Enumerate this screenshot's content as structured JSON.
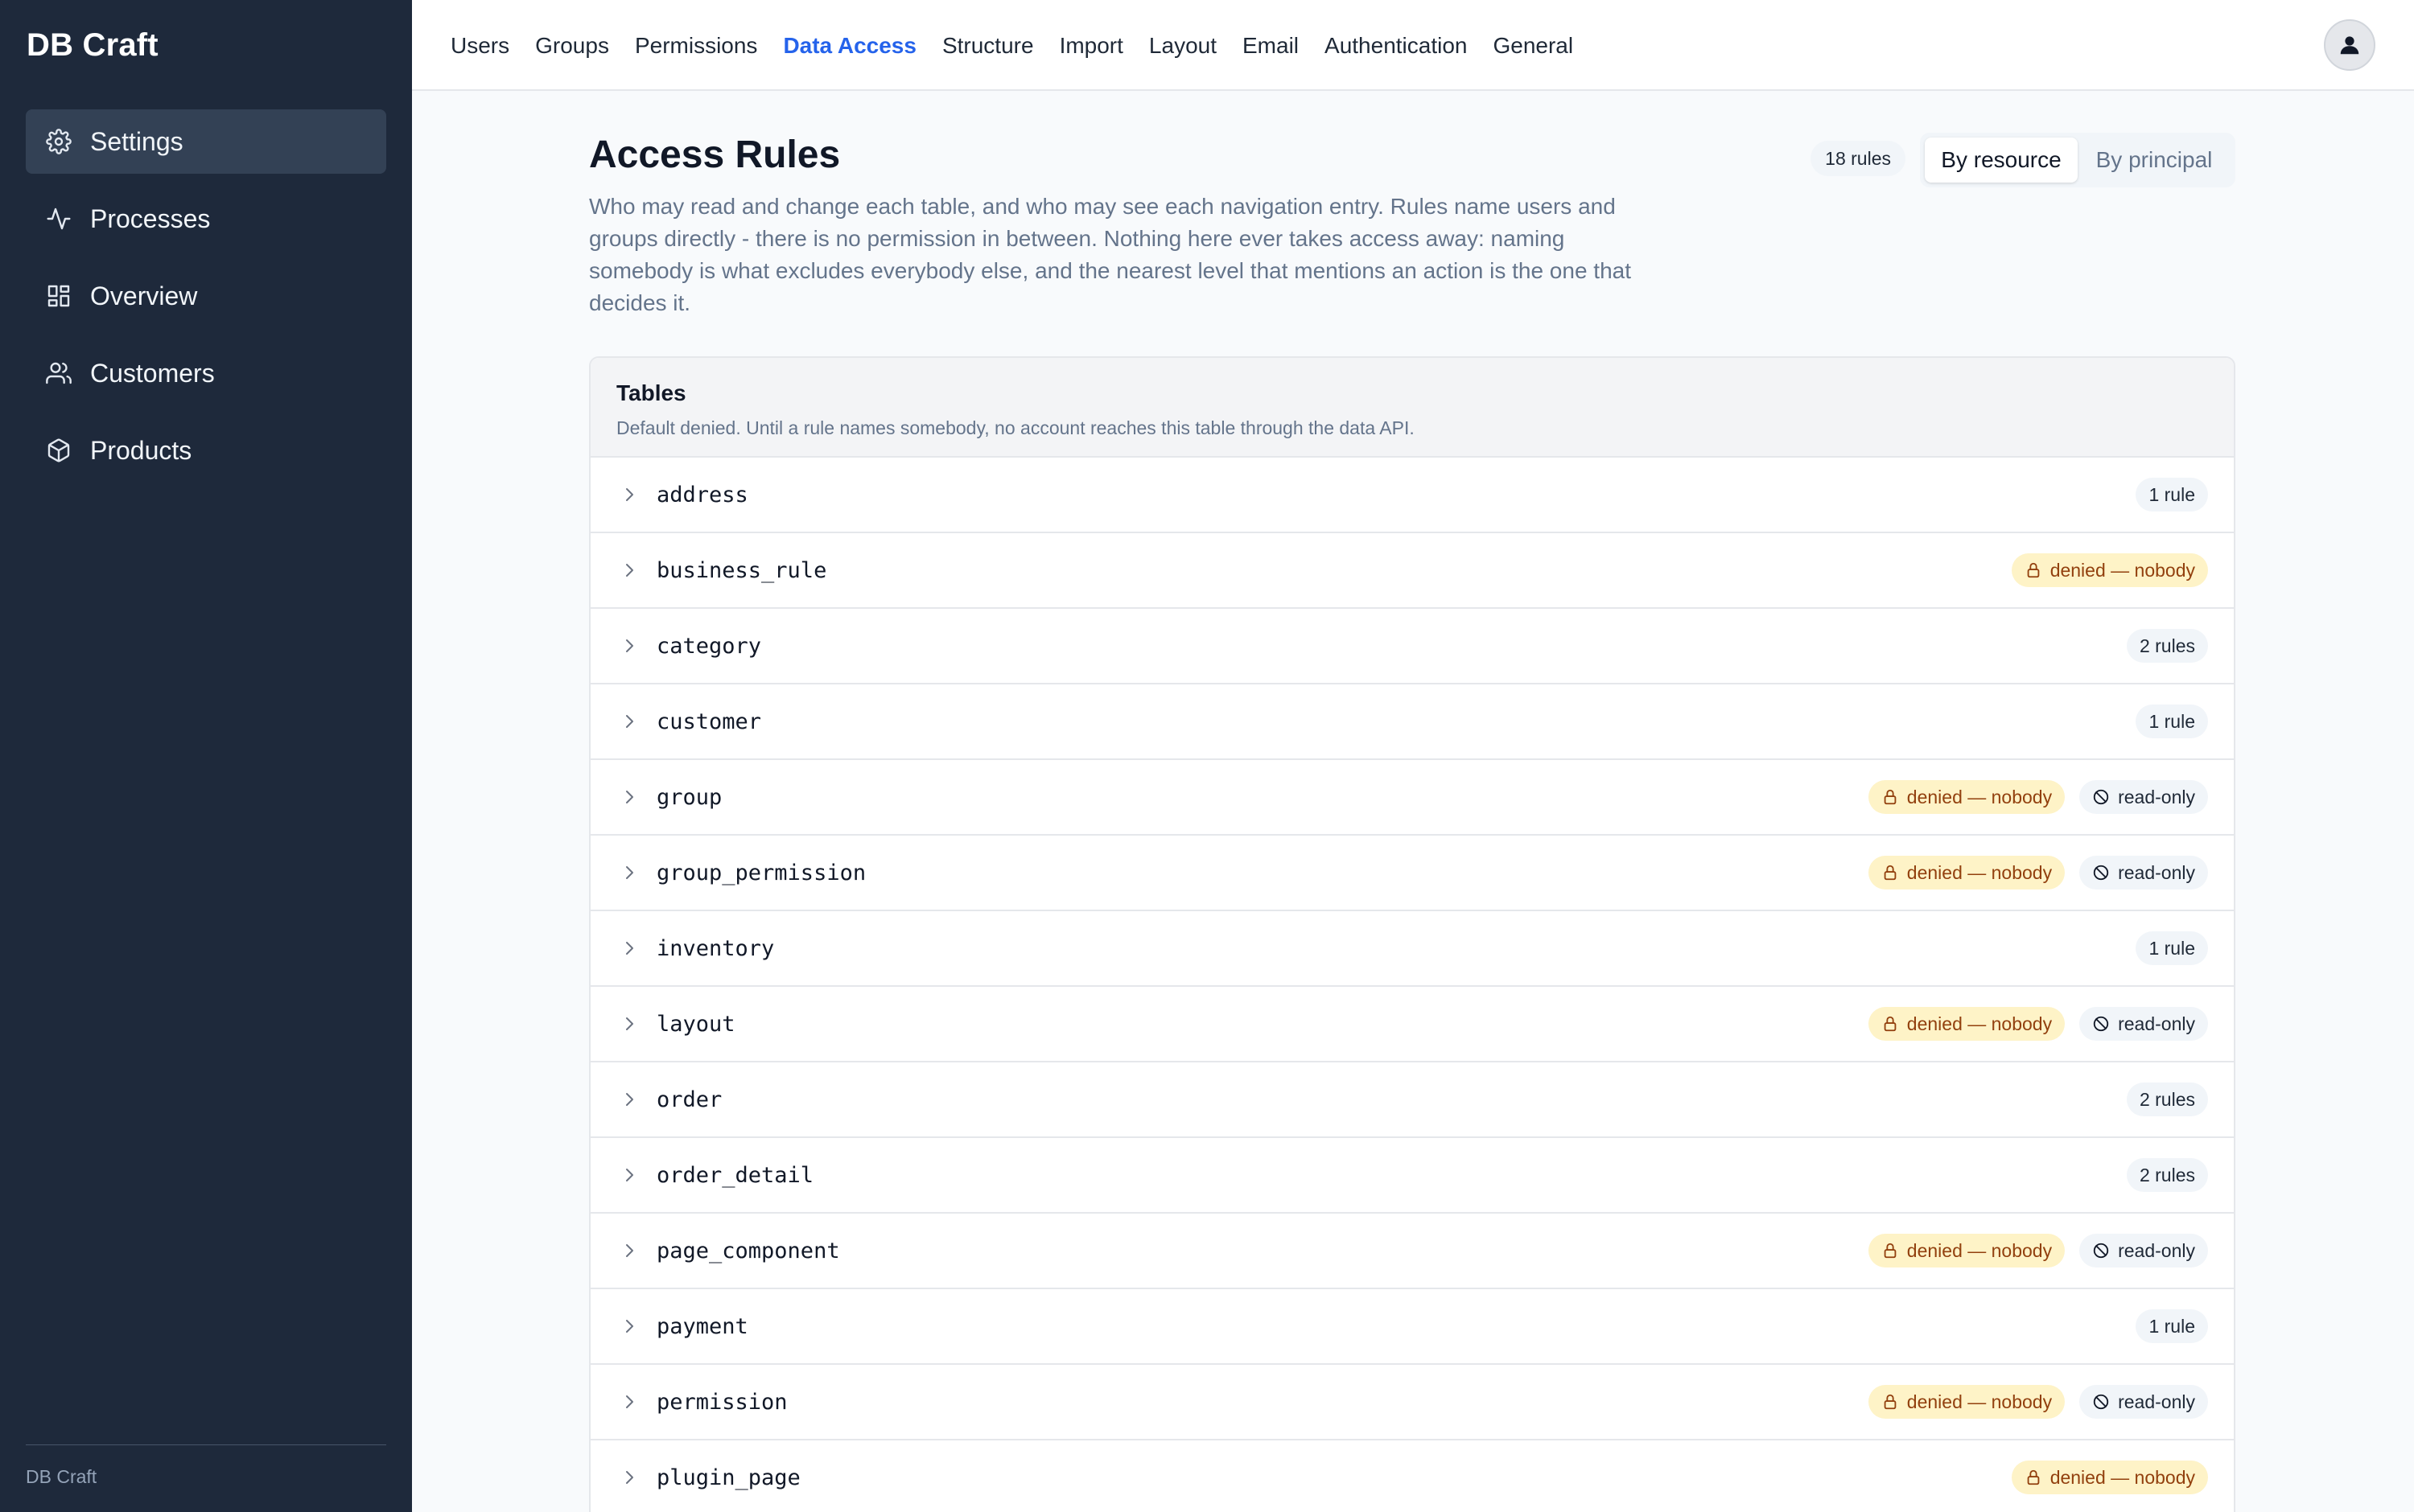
{
  "app": {
    "brand": "DB Craft",
    "footer": "DB Craft"
  },
  "sidebar": {
    "items": [
      {
        "label": "Settings",
        "icon": "gear-icon",
        "active": true
      },
      {
        "label": "Processes",
        "icon": "activity-icon",
        "active": false
      },
      {
        "label": "Overview",
        "icon": "dashboard-icon",
        "active": false
      },
      {
        "label": "Customers",
        "icon": "users-icon",
        "active": false
      },
      {
        "label": "Products",
        "icon": "package-icon",
        "active": false
      }
    ]
  },
  "topnav": {
    "items": [
      "Users",
      "Groups",
      "Permissions",
      "Data Access",
      "Structure",
      "Import",
      "Layout",
      "Email",
      "Authentication",
      "General"
    ],
    "active": "Data Access"
  },
  "page": {
    "title": "Access Rules",
    "description": "Who may read and change each table, and who may see each navigation entry. Rules name users and groups directly - there is no permission in between. Nothing here ever takes access away: naming somebody is what excludes everybody else, and the nearest level that mentions an action is the one that decides it.",
    "rules_count": "18 rules",
    "view_toggle": {
      "by_resource": "By resource",
      "by_principal": "By principal",
      "selected": "By resource"
    }
  },
  "tables_section": {
    "title": "Tables",
    "subtitle": "Default denied. Until a rule names somebody, no account reaches this table through the data API.",
    "rows": [
      {
        "name": "address",
        "count": "1 rule",
        "denied": null,
        "readonly": null
      },
      {
        "name": "business_rule",
        "count": null,
        "denied": "denied — nobody",
        "readonly": null
      },
      {
        "name": "category",
        "count": "2 rules",
        "denied": null,
        "readonly": null
      },
      {
        "name": "customer",
        "count": "1 rule",
        "denied": null,
        "readonly": null
      },
      {
        "name": "group",
        "count": null,
        "denied": "denied — nobody",
        "readonly": "read-only"
      },
      {
        "name": "group_permission",
        "count": null,
        "denied": "denied — nobody",
        "readonly": "read-only"
      },
      {
        "name": "inventory",
        "count": "1 rule",
        "denied": null,
        "readonly": null
      },
      {
        "name": "layout",
        "count": null,
        "denied": "denied — nobody",
        "readonly": "read-only"
      },
      {
        "name": "order",
        "count": "2 rules",
        "denied": null,
        "readonly": null
      },
      {
        "name": "order_detail",
        "count": "2 rules",
        "denied": null,
        "readonly": null
      },
      {
        "name": "page_component",
        "count": null,
        "denied": "denied — nobody",
        "readonly": "read-only"
      },
      {
        "name": "payment",
        "count": "1 rule",
        "denied": null,
        "readonly": null
      },
      {
        "name": "permission",
        "count": null,
        "denied": "denied — nobody",
        "readonly": "read-only"
      },
      {
        "name": "plugin_page",
        "count": null,
        "denied": "denied — nobody",
        "readonly": null
      }
    ]
  },
  "colors": {
    "sidebar_bg": "#1e293b",
    "sidebar_active": "#334155",
    "accent": "#2563eb",
    "denied_bg": "#fef3c7",
    "denied_text": "#92400e"
  }
}
